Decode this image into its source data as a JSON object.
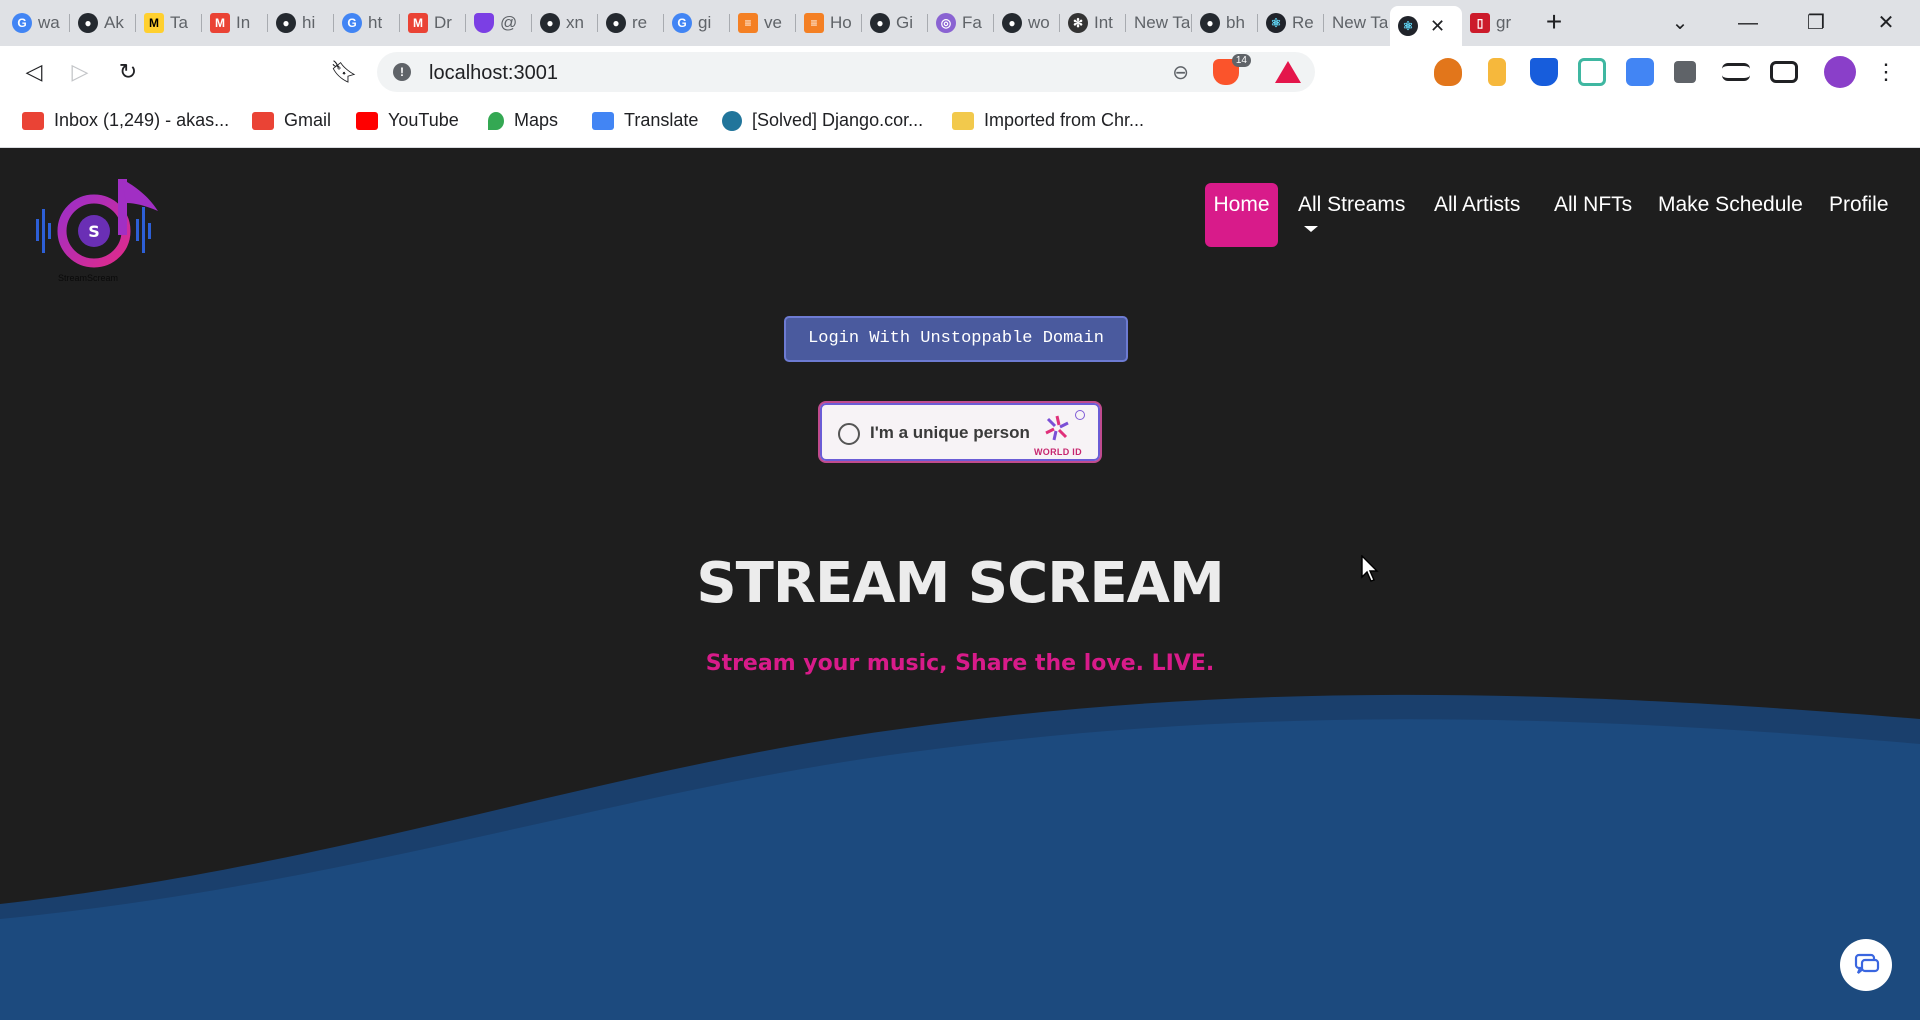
{
  "browser": {
    "tabs": [
      {
        "title": "wa",
        "icon": "google-icon",
        "color": "#4285f4"
      },
      {
        "title": "Ak",
        "icon": "github-icon",
        "color": "#24292f"
      },
      {
        "title": "Ta",
        "icon": "miro-icon",
        "color": "#ffd02f"
      },
      {
        "title": "In",
        "icon": "gmail-icon",
        "color": "#ea4335"
      },
      {
        "title": "hi",
        "icon": "github-icon",
        "color": "#24292f"
      },
      {
        "title": "ht",
        "icon": "google-icon",
        "color": "#4285f4"
      },
      {
        "title": "Dr",
        "icon": "gmail-icon",
        "color": "#ea4335"
      },
      {
        "title": "@",
        "icon": "shield-icon",
        "color": "#7b3fe4"
      },
      {
        "title": "xn",
        "icon": "github-icon",
        "color": "#24292f"
      },
      {
        "title": "re",
        "icon": "github-icon",
        "color": "#24292f"
      },
      {
        "title": "gi",
        "icon": "google-icon",
        "color": "#4285f4"
      },
      {
        "title": "ve",
        "icon": "stackoverflow-icon",
        "color": "#f48024"
      },
      {
        "title": "Ho",
        "icon": "stackoverflow-icon",
        "color": "#f48024"
      },
      {
        "title": "Gi",
        "icon": "github-icon",
        "color": "#24292f"
      },
      {
        "title": "Fa",
        "icon": "faucet-icon",
        "color": "#8a63d2"
      },
      {
        "title": "wo",
        "icon": "github-icon",
        "color": "#24292f"
      },
      {
        "title": "Int",
        "icon": "flower-icon",
        "color": "#333333"
      },
      {
        "title": "New Ta",
        "icon": "",
        "color": ""
      },
      {
        "title": "bh",
        "icon": "github-icon",
        "color": "#24292f"
      },
      {
        "title": "Re",
        "icon": "react-icon",
        "color": "#20232a"
      },
      {
        "title": "New Ta",
        "icon": "",
        "color": ""
      },
      {
        "title": "",
        "icon": "react-icon",
        "color": "#20232a",
        "active": true
      },
      {
        "title": "gr",
        "icon": "opera-icon",
        "color": "#cc1b2b"
      }
    ],
    "address": "localhost:3001",
    "brave_badge": "14",
    "bookmarks": [
      {
        "label": "Inbox (1,249) - akas...",
        "icon": "gmail-icon",
        "color": "#ea4335"
      },
      {
        "label": "Gmail",
        "icon": "gmail-icon",
        "color": "#ea4335"
      },
      {
        "label": "YouTube",
        "icon": "youtube-icon",
        "color": "#ff0000"
      },
      {
        "label": "Maps",
        "icon": "maps-icon",
        "color": "#34a853"
      },
      {
        "label": "Translate",
        "icon": "translate-icon",
        "color": "#4285f4"
      },
      {
        "label": "[Solved] Django.cor...",
        "icon": "wordpress-icon",
        "color": "#21759b"
      },
      {
        "label": "Imported from Chr...",
        "icon": "folder-icon",
        "color": "#f2c94c"
      }
    ]
  },
  "site": {
    "logo_text": "StreamScream",
    "nav": [
      {
        "label": "Home",
        "active": true
      },
      {
        "label": "All Streams",
        "active": false
      },
      {
        "label": "All Artists",
        "active": false
      },
      {
        "label": "All NFTs",
        "active": false
      },
      {
        "label": "Make Schedule",
        "active": false
      },
      {
        "label": "Profile",
        "active": false
      }
    ],
    "login_button": "Login With Unstoppable Domain",
    "world_id": {
      "label": "I'm a unique person",
      "brand": "WORLD ID"
    },
    "title": "STREAM SCREAM",
    "tagline": "Stream your music, Share the love. LIVE."
  },
  "colors": {
    "accent": "#d81b8a",
    "page_bg": "#1e1e1e",
    "wave": "#1c4a7e",
    "login_button": "#4a5a9e"
  }
}
